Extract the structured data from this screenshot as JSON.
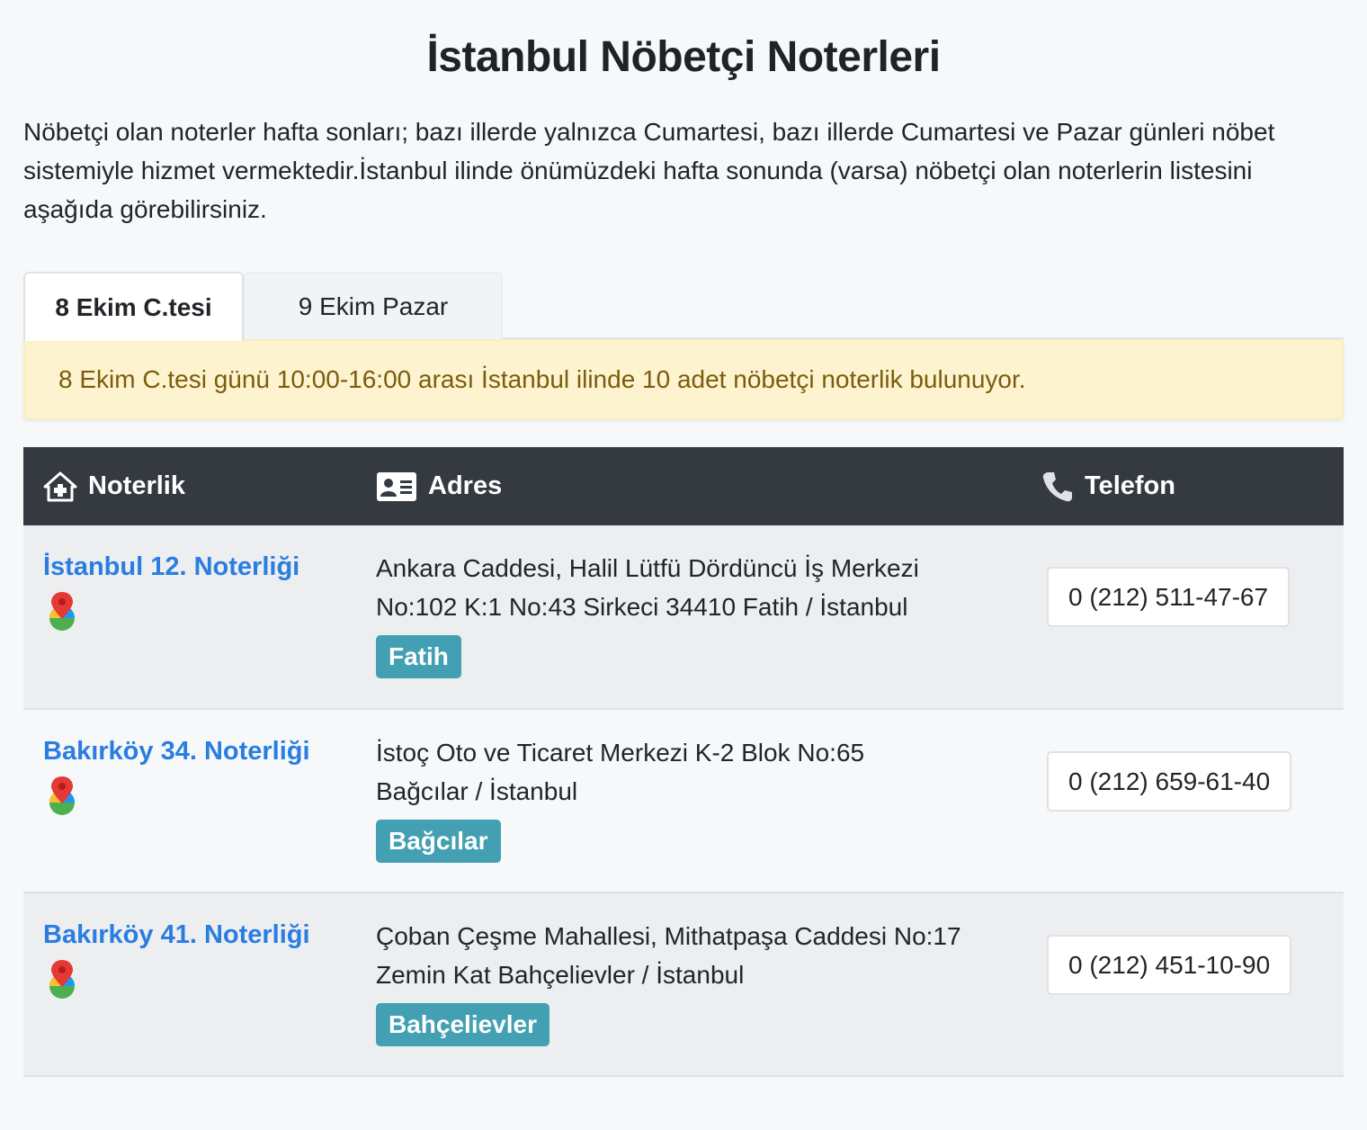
{
  "page": {
    "title": "İstanbul Nöbetçi Noterleri",
    "intro": "Nöbetçi olan noterler hafta sonları; bazı illerde yalnızca Cumartesi, bazı illerde Cumartesi ve Pazar günleri nöbet sistemiyle hizmet vermektedir.İstanbul ilinde önümüzdeki hafta sonunda (varsa) nöbetçi olan noterlerin listesini aşağıda görebilirsiniz."
  },
  "tabs": [
    {
      "label": "8 Ekim C.tesi",
      "active": true
    },
    {
      "label": "9 Ekim Pazar",
      "active": false
    }
  ],
  "alert": "8 Ekim C.tesi günü 10:00-16:00 arası İstanbul ilinde 10 adet nöbetçi noterlik bulunuyor.",
  "table": {
    "headers": {
      "noterlik": "Noterlik",
      "adres": "Adres",
      "telefon": "Telefon"
    },
    "rows": [
      {
        "name": "İstanbul 12. Noterliği",
        "address_line1": "Ankara Caddesi, Halil Lütfü Dördüncü İş Merkezi",
        "address_line2": "No:102 K:1 No:43 Sirkeci 34410 Fatih / İstanbul",
        "district": "Fatih",
        "phone": "0 (212) 511-47-67"
      },
      {
        "name": "Bakırköy 34. Noterliği",
        "address_line1": "İstoç Oto ve Ticaret Merkezi K-2 Blok No:65",
        "address_line2": "Bağcılar / İstanbul",
        "district": "Bağcılar",
        "phone": "0 (212) 659-61-40"
      },
      {
        "name": "Bakırköy 41. Noterliği",
        "address_line1": "Çoban Çeşme Mahallesi, Mithatpaşa Caddesi No:17",
        "address_line2": "Zemin Kat Bahçelievler / İstanbul",
        "district": "Bahçelievler",
        "phone": "0 (212) 451-10-90"
      }
    ]
  },
  "icons": {
    "header_noterlik": "house-icon",
    "header_adres": "id-card-icon",
    "header_telefon": "phone-icon",
    "row_map": "map-pin-icon"
  },
  "colors": {
    "link": "#2a7de1",
    "badge": "#43a0b2",
    "table_header": "#343a40",
    "alert_bg": "#fdf3cf",
    "alert_text": "#7a5d0d"
  }
}
